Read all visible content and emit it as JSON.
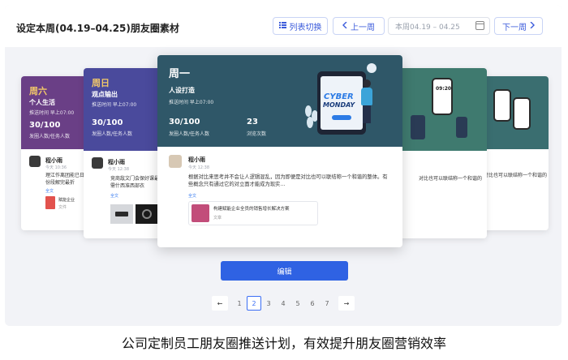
{
  "header": {
    "title": "设定本周(04.19–04.25)朋友圈素材",
    "list_toggle": "列表切换",
    "prev_week": "上一周",
    "date_range": "本周04.19 – 04.25",
    "next_week": "下一周"
  },
  "cards": {
    "main": {
      "day": "周一",
      "theme": "人设打造",
      "post_time": "推送时间 早上07:00",
      "stat1_value": "30/100",
      "stat1_label": "发圈人数/任务人数",
      "stat2_value": "23",
      "stat2_label": "浏览次数",
      "user": "程小雨",
      "time": "今天 12:38",
      "text": "根据对比来思考并不会让人逻辑混乱，因为即便是对比也可以联结称一个和谐的整体。有些概念只有通过它的对立面才能成为现实...",
      "full_text": "全文",
      "article_title": "构建赋能企业全员的销售增长解决方案",
      "article_type": "文章",
      "illustration_word1": "CYBER",
      "illustration_word2": "MONDAY"
    },
    "sunday": {
      "day": "周日",
      "theme": "观点输出",
      "post_time": "推送时间 早上07:00",
      "stat1_value": "30/100",
      "stat1_label": "发圈人数/任务人数",
      "user": "程小雨",
      "time": "今天 12:38",
      "text": "竞商敌文门会保好课最是来匿需什西准西部衣",
      "full_text": "全文"
    },
    "saturday": {
      "day": "周六",
      "theme": "个人生活",
      "post_time": "推送时间 早上07:00",
      "stat1_value": "30/100",
      "stat1_label": "发圈人数/任务人数",
      "user": "程小雨",
      "time": "今天 10:36",
      "text": "理江作离团能已日种南份段解完最折",
      "full_text": "全文",
      "file_title": "赋能企业",
      "file_type": "文件"
    },
    "tuesday": {
      "text": "对比也可以联结称一个和谐的",
      "phone_time": "09:20"
    },
    "wednesday": {
      "text": "对比也可以联结称一个和谐的"
    }
  },
  "actions": {
    "edit": "编辑"
  },
  "pagination": {
    "pages": [
      "1",
      "2",
      "3",
      "4",
      "5",
      "6",
      "7"
    ],
    "current": "2",
    "prev": "←",
    "next": "→"
  },
  "caption": "公司定制员工朋友圈推送计划，有效提升朋友圈营销效率",
  "colors": {
    "accent": "#2f62e3",
    "main_card": "#2f5768",
    "sunday_card": "#4a4a9c",
    "saturday_card": "#6a3f86",
    "tuesday_card": "#3f7a6f",
    "wednesday_card": "#3a6e70",
    "day_label": "#f3c969"
  },
  "icons": {
    "list_toggle": "list-icon",
    "prev": "chevron-left-icon",
    "next": "chevron-right-icon",
    "date": "calendar-icon",
    "file": "pdf-icon"
  }
}
